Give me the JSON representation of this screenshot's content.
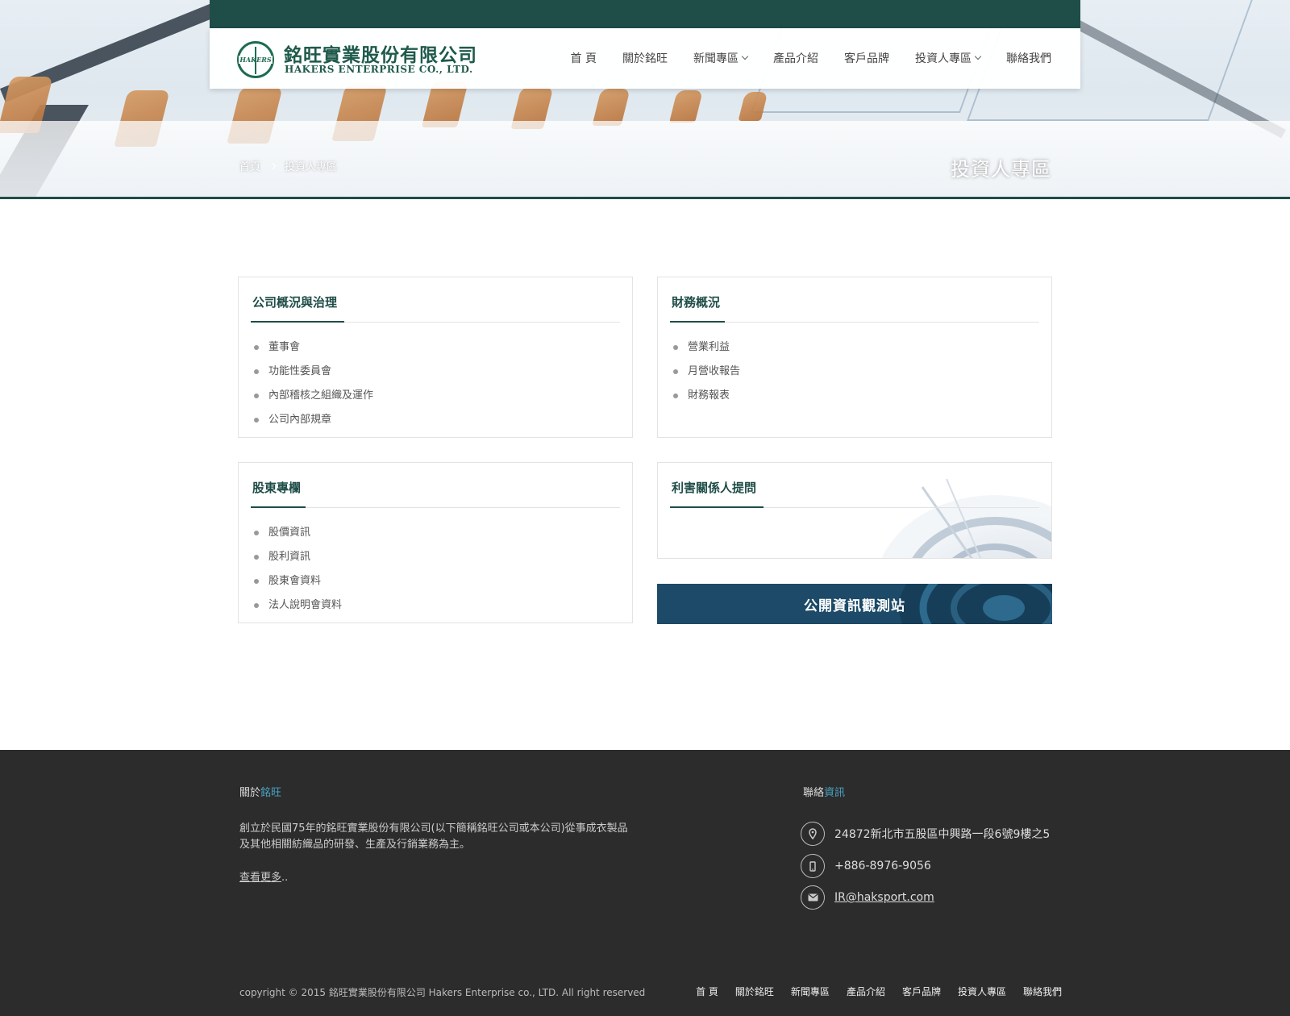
{
  "header": {
    "logo_zh": "銘旺實業股份有限公司",
    "logo_en": "HAKERS ENTERPRISE CO., LTD.",
    "logo_badge": "HAKERS",
    "nav": [
      {
        "label": "首 頁"
      },
      {
        "label": "關於銘旺"
      },
      {
        "label": "新聞專區",
        "dropdown": true
      },
      {
        "label": "產品介紹"
      },
      {
        "label": "客戶品牌"
      },
      {
        "label": "投資人專區",
        "dropdown": true
      },
      {
        "label": "聯絡我們"
      }
    ]
  },
  "hero": {
    "breadcrumb": [
      "首頁",
      "投資人專區"
    ],
    "title": "投資人專區"
  },
  "panels": {
    "governance": {
      "title": "公司概況與治理",
      "items": [
        "董事會",
        "功能性委員會",
        "內部稽核之組織及運作",
        "公司內部規章"
      ]
    },
    "finance": {
      "title": "財務概況",
      "items": [
        "營業利益",
        "月營收報告",
        "財務報表"
      ]
    },
    "shareholders": {
      "title": "股東專欄",
      "items": [
        "股價資訊",
        "股利資訊",
        "股東會資料",
        "法人說明會資料"
      ]
    },
    "stakeholders": {
      "title": "利害關係人提問"
    },
    "mops_button": "公開資訊觀測站"
  },
  "footer": {
    "about_heading_prefix": "關於",
    "about_heading_accent": "銘旺",
    "about_text": "創立於民國75年的銘旺實業股份有限公司(以下簡稱銘旺公司或本公司)從事成衣製品及其他相關紡織品的研發、生產及行銷業務為主。",
    "more_link": "查看更多",
    "more_suffix": "..",
    "contact_heading_prefix": "聯絡",
    "contact_heading_accent": "資訊",
    "address": "24872新北市五股區中興路一段6號9樓之5",
    "phone": "+886-8976-9056",
    "email": "IR@haksport.com",
    "copyright": "copyright © 2015 銘旺實業股份有限公司 Hakers Enterprise co., LTD. All right reserved",
    "nav": [
      "首 頁",
      "關於銘旺",
      "新聞專區",
      "產品介紹",
      "客戶品牌",
      "投資人專區",
      "聯絡我們"
    ]
  },
  "colors": {
    "brand_green": "#1f4d48",
    "mops_blue": "#1c4a68",
    "footer_bg": "#2c2c2c",
    "footer_accent": "#4aa3c4"
  }
}
